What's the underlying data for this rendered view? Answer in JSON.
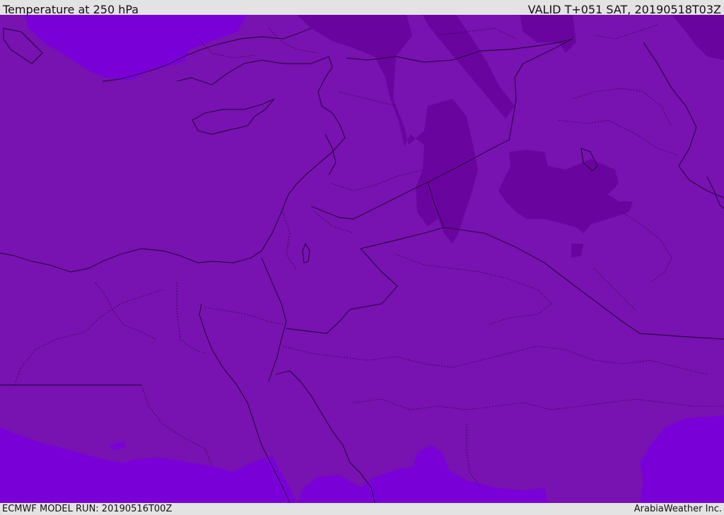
{
  "header": {
    "title": "Temperature at 250 hPa",
    "valid": "VALID T+051 SAT, 20190518T03Z"
  },
  "footer": {
    "model_run": "ECMWF MODEL RUN: 20190516T00Z",
    "credit": "ArabiaWeather Inc."
  },
  "colors": {
    "base_field": "#7812b0",
    "warm_field": "#7a00d8",
    "cold_field": "#6a049e",
    "lines": "#1a0530"
  }
}
